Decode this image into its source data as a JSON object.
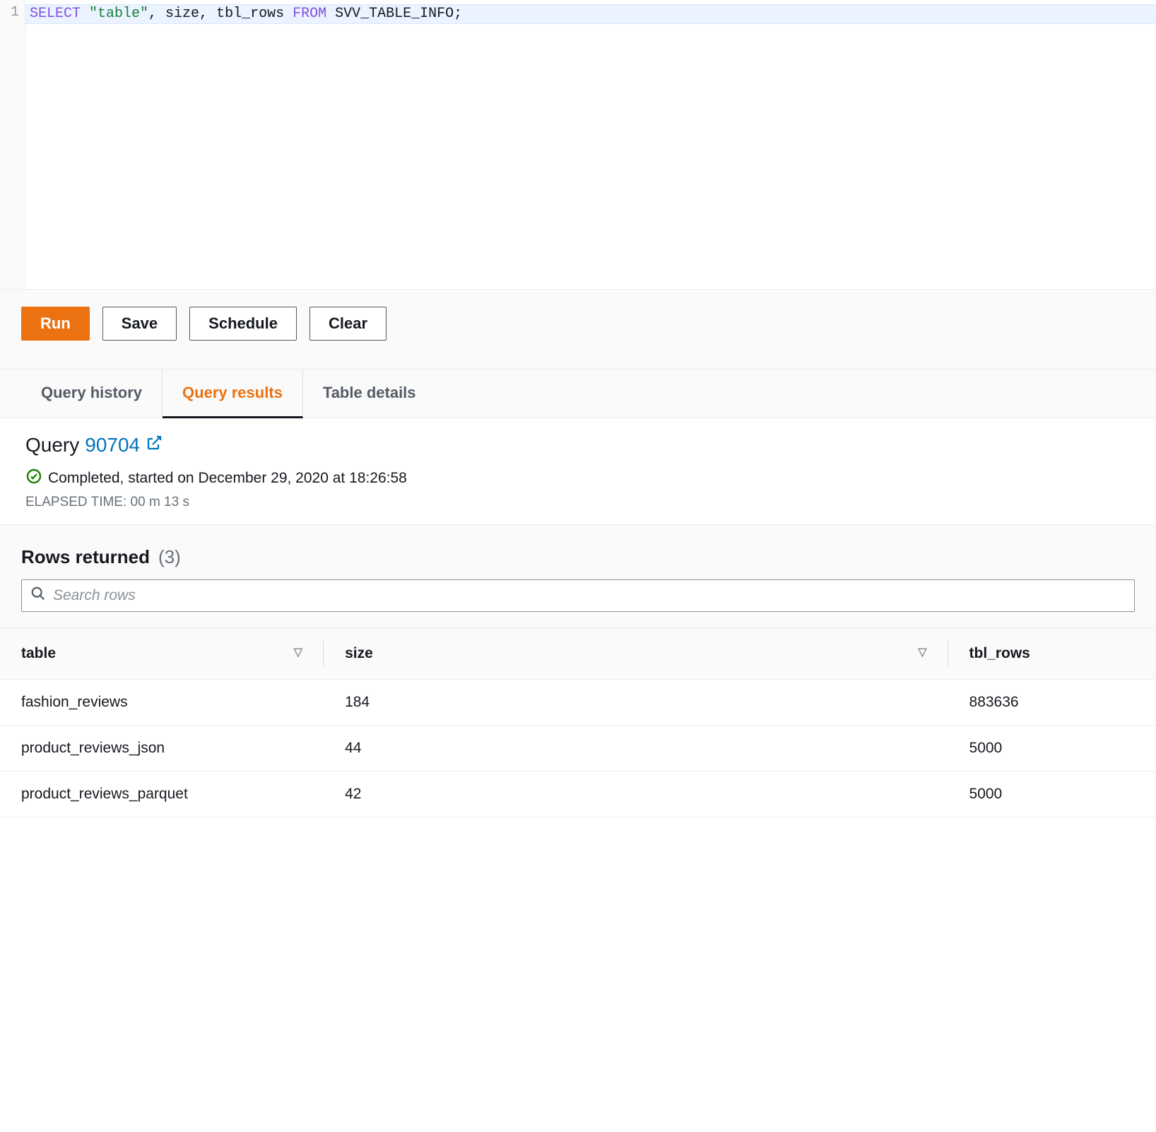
{
  "editor": {
    "line_number": "1",
    "sql_select": "SELECT",
    "sql_string": "\"table\"",
    "sql_rest1": ", size, tbl_rows ",
    "sql_from": "FROM",
    "sql_rest2": " SVV_TABLE_INFO;"
  },
  "actions": {
    "run": "Run",
    "save": "Save",
    "schedule": "Schedule",
    "clear": "Clear"
  },
  "tabs": {
    "history": "Query history",
    "results": "Query results",
    "details": "Table details"
  },
  "query": {
    "title_prefix": "Query",
    "id": "90704",
    "status": "Completed, started on December 29, 2020 at 18:26:58",
    "elapsed": "ELAPSED TIME: 00 m 13 s"
  },
  "results": {
    "rows_label": "Rows returned",
    "rows_count": "(3)",
    "search_placeholder": "Search rows",
    "columns": {
      "table": "table",
      "size": "size",
      "tbl_rows": "tbl_rows"
    },
    "rows": [
      {
        "table": "fashion_reviews",
        "size": "184",
        "tbl_rows": "883636"
      },
      {
        "table": "product_reviews_json",
        "size": "44",
        "tbl_rows": "5000"
      },
      {
        "table": "product_reviews_parquet",
        "size": "42",
        "tbl_rows": "5000"
      }
    ]
  }
}
